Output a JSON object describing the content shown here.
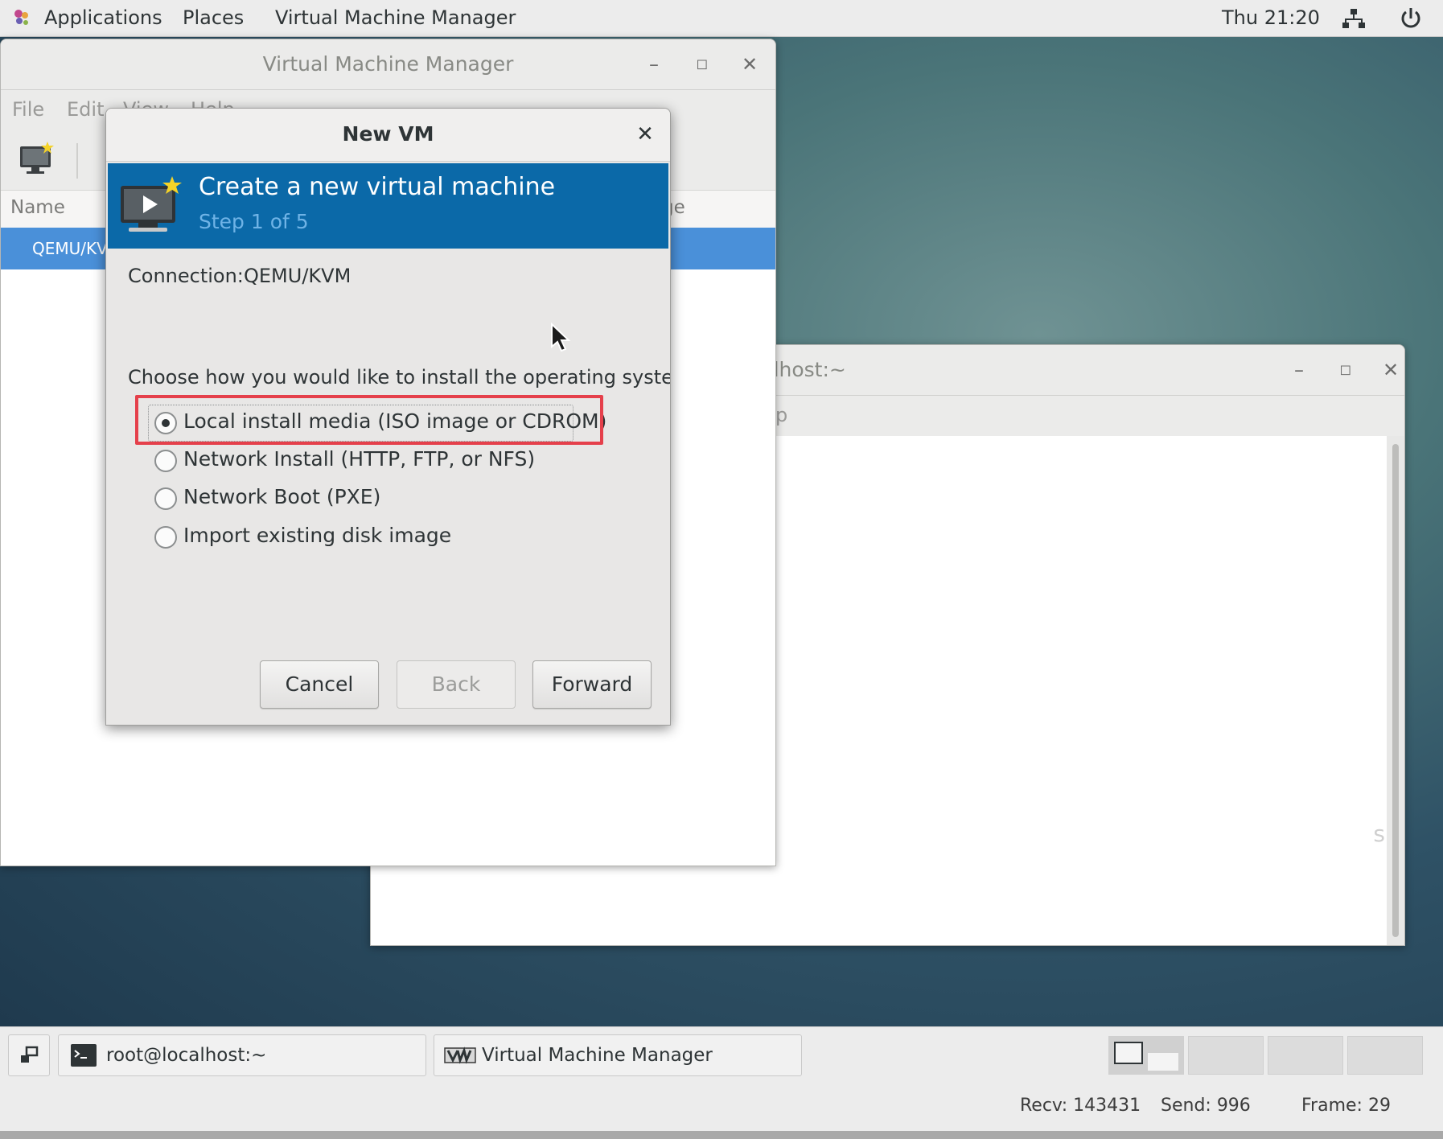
{
  "top_bar": {
    "applications": "Applications",
    "places": "Places",
    "app_menu": "Virtual Machine Manager",
    "clock": "Thu 21:20"
  },
  "vmm_window": {
    "title": "Virtual Machine Manager",
    "menu": [
      "File",
      "Edit",
      "View",
      "Help"
    ],
    "list_header_name": "Name",
    "list_header_usage_fragment": "ge",
    "row_connection": "QEMU/KV"
  },
  "terminal_window": {
    "title": "root@localhost:~",
    "menu_fragment": "p",
    "body_fragment": "s"
  },
  "dialog": {
    "title": "New VM",
    "banner_title": "Create a new virtual machine",
    "banner_step": "Step 1 of 5",
    "connection_label": "Connection:",
    "connection_value": "QEMU/KVM",
    "prompt": "Choose how you would like to install the operating system",
    "options": [
      {
        "label": "Local install media (ISO image or CDROM)",
        "checked": true
      },
      {
        "label": "Network Install (HTTP, FTP, or NFS)",
        "checked": false
      },
      {
        "label": "Network Boot (PXE)",
        "checked": false
      },
      {
        "label": "Import existing disk image",
        "checked": false
      }
    ],
    "buttons": {
      "cancel": "Cancel",
      "back": "Back",
      "forward": "Forward"
    }
  },
  "taskbar": {
    "items": [
      "root@localhost:~",
      "Virtual Machine Manager"
    ]
  },
  "status": {
    "recv": "Recv: 143431",
    "send": "Send: 996",
    "frame": "Frame: 29"
  },
  "colors": {
    "banner": "#0b69a8",
    "selection": "#4a90d9",
    "highlight": "#e5404b"
  }
}
